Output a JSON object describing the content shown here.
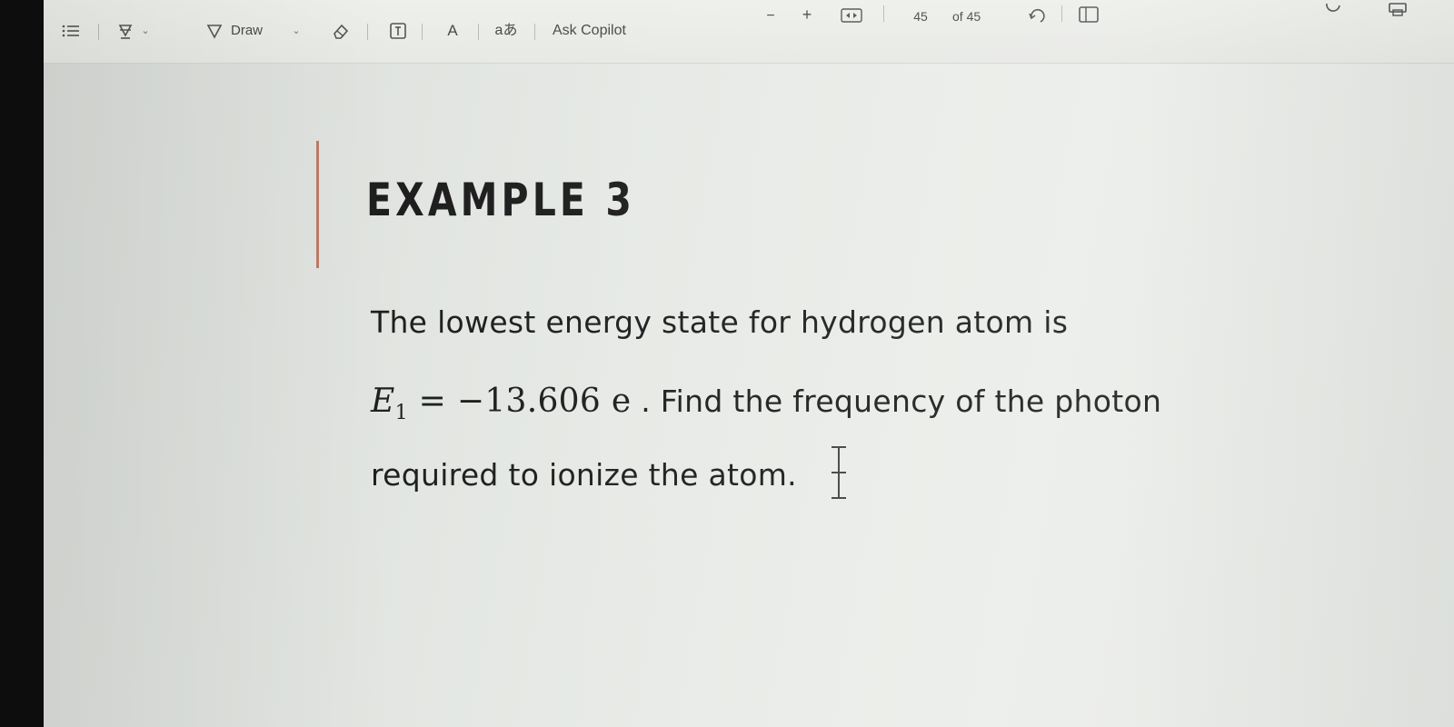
{
  "toolbar": {
    "draw_label": "Draw",
    "copilot_label": "Ask Copilot",
    "page_current": "45",
    "page_total": "of 45",
    "text_style_glyph": "A",
    "translate_glyph": "aあ",
    "zoom_out_glyph": "−",
    "zoom_in_glyph": "+"
  },
  "document": {
    "title": "EXAMPLE 3",
    "line1": "The lowest energy state for hydrogen atom is",
    "eq_var": "E",
    "eq_sub": "1",
    "eq_rest": " = −13.606 e",
    "line2_rest": " . Find the frequency of the photon",
    "line3": "required to ionize the atom."
  },
  "colors": {
    "toolbar_bg": "#eef0ec",
    "page_bg": "#e6e9e5",
    "text": "#1f1f1f",
    "margin_accent": "#b46a52"
  }
}
